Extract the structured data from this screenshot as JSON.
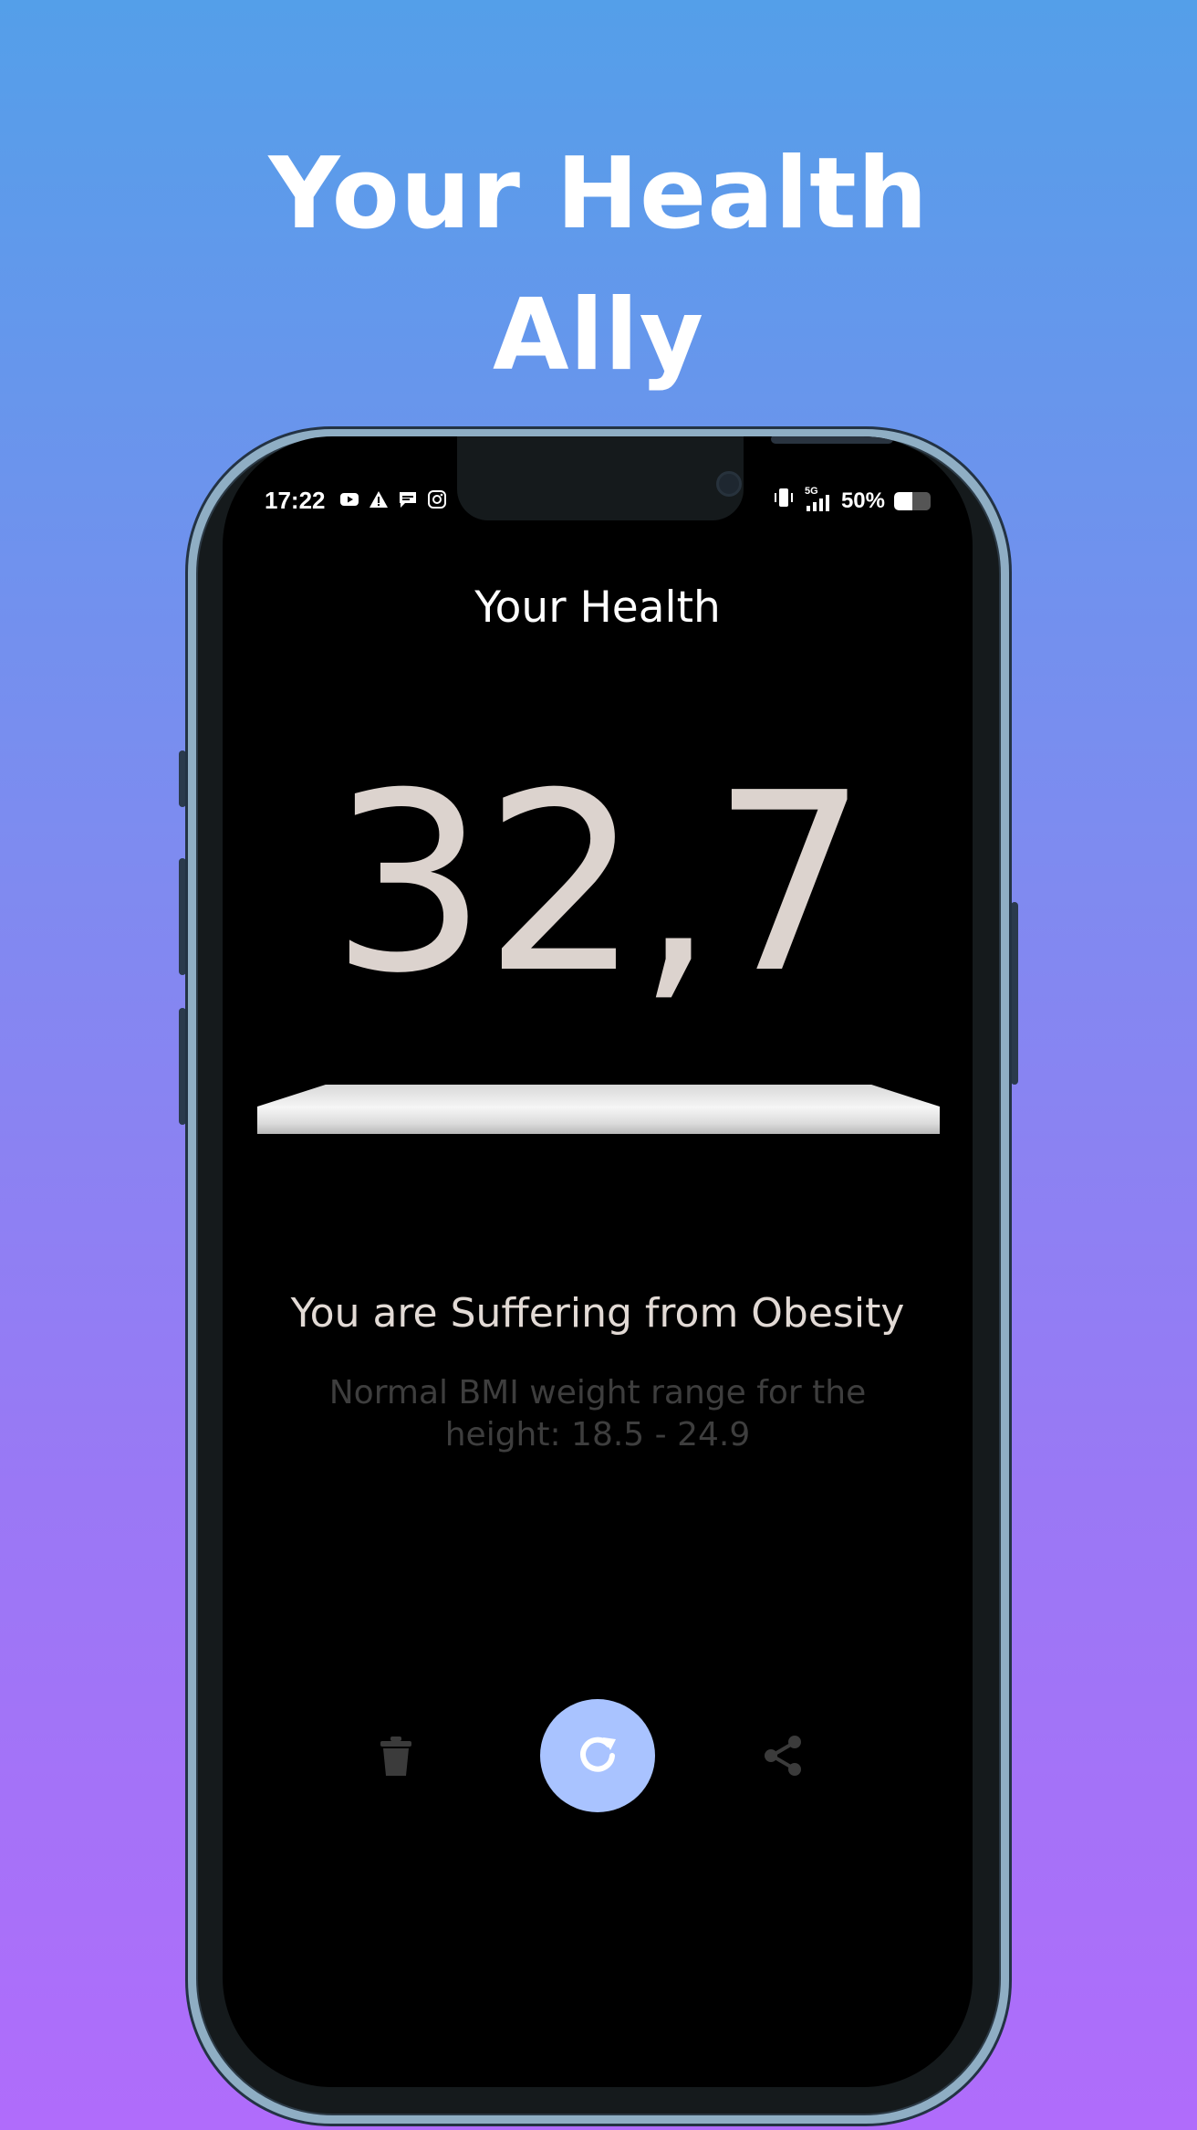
{
  "promo": {
    "title_line1": "Your Health",
    "title_line2": "Ally"
  },
  "status_bar": {
    "time": "17:22",
    "left_icons": [
      "youtube-icon",
      "warning-icon",
      "message-icon",
      "instagram-icon"
    ],
    "network_label": "5G",
    "battery_percent": "50%",
    "battery_level": 0.5
  },
  "screen": {
    "title": "Your Health",
    "bmi_value": "32,7",
    "result_label": "You are Suffering from Obesity",
    "range_line1": "Normal BMI weight range for the",
    "range_line2": "height: 18.5 - 24.9"
  },
  "actions": {
    "delete_icon": "trash-icon",
    "reset_icon": "refresh-icon",
    "share_icon": "share-icon"
  },
  "colors": {
    "background_top": "#549fe9",
    "background_bottom": "#b06cfb",
    "bmi_value": "#dcd3ce",
    "accent_button": "#a9c3ff",
    "muted_text": "#3e3e3e"
  }
}
